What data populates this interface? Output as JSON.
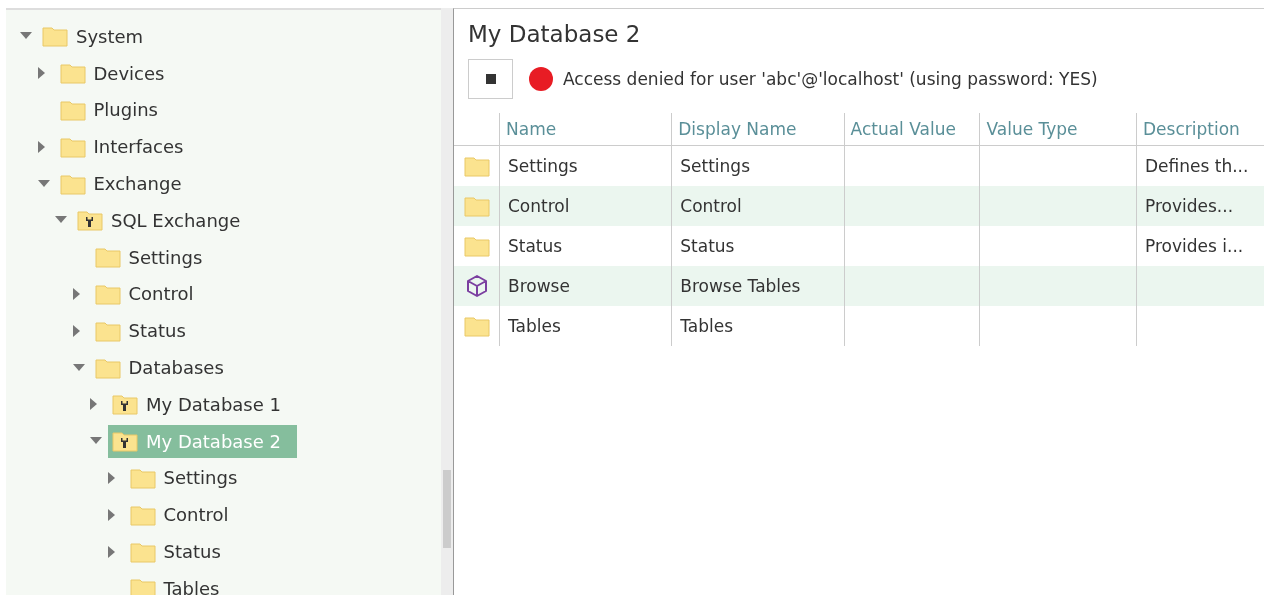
{
  "tree": [
    {
      "label": "System",
      "kind": "folder",
      "expanded": true,
      "selected": false,
      "children": [
        {
          "label": "Devices",
          "kind": "folder",
          "expanded": false,
          "selected": false
        },
        {
          "label": "Plugins",
          "kind": "folder",
          "selected": false
        },
        {
          "label": "Interfaces",
          "kind": "folder",
          "expanded": false,
          "selected": false
        },
        {
          "label": "Exchange",
          "kind": "folder",
          "expanded": true,
          "selected": false,
          "children": [
            {
              "label": "SQL Exchange",
              "kind": "service",
              "expanded": true,
              "selected": false,
              "children": [
                {
                  "label": "Settings",
                  "kind": "folder",
                  "selected": false
                },
                {
                  "label": "Control",
                  "kind": "folder",
                  "expanded": false,
                  "selected": false
                },
                {
                  "label": "Status",
                  "kind": "folder",
                  "expanded": false,
                  "selected": false
                },
                {
                  "label": "Databases",
                  "kind": "folder",
                  "expanded": true,
                  "selected": false,
                  "children": [
                    {
                      "label": "My Database 1",
                      "kind": "service",
                      "expanded": false,
                      "selected": false
                    },
                    {
                      "label": "My Database 2",
                      "kind": "service",
                      "expanded": true,
                      "selected": true,
                      "children": [
                        {
                          "label": "Settings",
                          "kind": "folder",
                          "expanded": false,
                          "selected": false
                        },
                        {
                          "label": "Control",
                          "kind": "folder",
                          "expanded": false,
                          "selected": false
                        },
                        {
                          "label": "Status",
                          "kind": "folder",
                          "expanded": false,
                          "selected": false
                        },
                        {
                          "label": "Tables",
                          "kind": "folder",
                          "selected": false
                        }
                      ]
                    }
                  ]
                }
              ]
            }
          ]
        }
      ]
    }
  ],
  "detail": {
    "title": "My Database 2",
    "status": {
      "message": "Access denied for user 'abc'@'localhost' (using password: YES)",
      "color": "#e81c24"
    },
    "table": {
      "columns": [
        "Name",
        "Display Name",
        "Actual Value",
        "Value Type",
        "Description"
      ],
      "rows": [
        {
          "kind": "folder",
          "cells": [
            "Settings",
            "Settings",
            "",
            "",
            "Defines th..."
          ]
        },
        {
          "kind": "folder",
          "cells": [
            "Control",
            "Control",
            "",
            "",
            "Provides..."
          ]
        },
        {
          "kind": "folder",
          "cells": [
            "Status",
            "Status",
            "",
            "",
            "Provides i..."
          ]
        },
        {
          "kind": "object",
          "cells": [
            "Browse",
            "Browse Tables",
            "",
            "",
            ""
          ]
        },
        {
          "kind": "folder",
          "cells": [
            "Tables",
            "Tables",
            "",
            "",
            ""
          ]
        }
      ]
    }
  }
}
